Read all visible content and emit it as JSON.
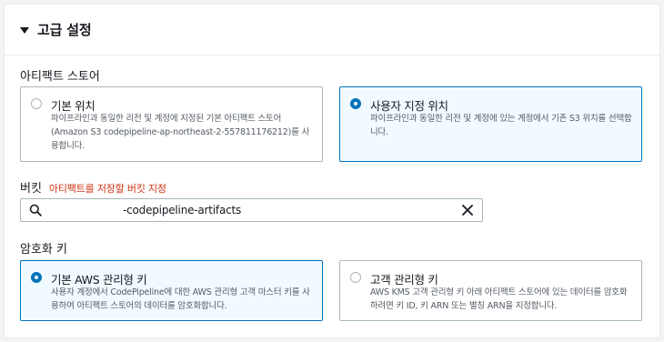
{
  "panel": {
    "title": "고급 설정"
  },
  "artifact_store": {
    "label": "아티팩트 스토어",
    "options": [
      {
        "title": "기본 위치",
        "description": "파이프라인과 동일한 리전 및 계정에 지정된 기본 아티팩트 스토어 (Amazon S3 codepipeline-ap-northeast-2-557811176212)를 사용합니다.",
        "selected": false
      },
      {
        "title": "사용자 지정 위치",
        "description": "파이프라인과 동일한 리전 및 계정에 있는 계정에서 기존 S3 위치를 선택합니다.",
        "selected": true
      }
    ]
  },
  "bucket": {
    "label": "버킷",
    "hint": "아티팩트를 저장할 버킷 지정",
    "value": "-codepipeline-artifacts"
  },
  "encryption": {
    "label": "암호화 키",
    "options": [
      {
        "title": "기본 AWS 관리형 키",
        "description": "사용자 계정에서 CodePipeline에 대한 AWS 관리형 고객 마스터 키를 사용하여 아티팩트 스토어의 데이터를 암호화합니다.",
        "selected": true
      },
      {
        "title": "고객 관리형 키",
        "description": "AWS KMS 고객 관리형 키 아래 아티팩트 스토어에 있는 데이터를 암호화하려면 키 ID, 키 ARN 또는 별칭 ARN을 지정합니다.",
        "selected": false
      }
    ]
  },
  "colors": {
    "accent": "#0073bb",
    "hint": "#d13212",
    "border": "#aab7b8"
  }
}
